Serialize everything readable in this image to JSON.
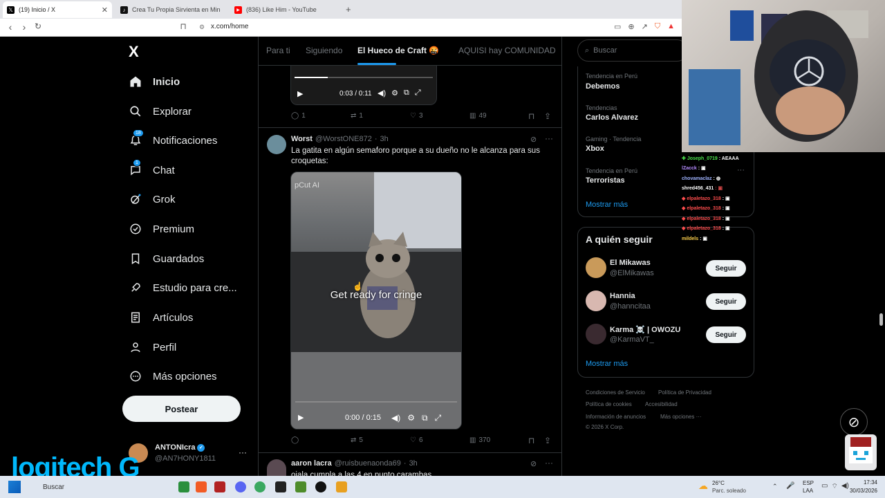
{
  "browser": {
    "tabs": [
      {
        "title": "(19) Inicio / X",
        "icon": "x-logo-icon"
      },
      {
        "title": "Crea Tu Propia Sirvienta en Minecraft",
        "icon": "tiktok-icon"
      },
      {
        "title": "(836) Like Him - YouTube",
        "icon": "youtube-icon"
      }
    ],
    "new_tab": "+",
    "url": "x.com/home"
  },
  "sidebar": {
    "logo": "X",
    "items": [
      {
        "label": "Inicio",
        "icon": "home-icon",
        "bold": true
      },
      {
        "label": "Explorar",
        "icon": "search-icon"
      },
      {
        "label": "Notificaciones",
        "icon": "bell-icon",
        "badge": "18"
      },
      {
        "label": "Chat",
        "icon": "chat-icon",
        "badge": "1"
      },
      {
        "label": "Grok",
        "icon": "grok-icon"
      },
      {
        "label": "Premium",
        "icon": "premium-icon"
      },
      {
        "label": "Guardados",
        "icon": "bookmark-icon"
      },
      {
        "label": "Estudio para cre...",
        "icon": "rocket-icon"
      },
      {
        "label": "Artículos",
        "icon": "article-icon"
      },
      {
        "label": "Perfil",
        "icon": "person-icon"
      },
      {
        "label": "Más opciones",
        "icon": "more-circle-icon"
      }
    ],
    "post_label": "Postear",
    "account": {
      "name": "ANTONIcra",
      "handle": "@AN7HONY1811"
    }
  },
  "feed_tabs": [
    "Para ti",
    "Siguiendo",
    "El Hueco de Craft 🤬",
    "AQUISI hay COMUNIDAD"
  ],
  "post_prev": {
    "video_time": "0:03 / 0:11",
    "replies": "1",
    "reposts": "1",
    "likes": "3",
    "views": "49"
  },
  "post_main": {
    "author": "Worst",
    "handle": "@WorstONE872",
    "time": "3h",
    "text": "La gatita en algún semaforo porque a su dueño no le alcanza para sus croquetas:",
    "watermark": "pCut AI",
    "caption": "Get ready for cringe",
    "video_time": "0:00 / 0:15",
    "replies": "",
    "reposts": "5",
    "likes": "6",
    "views": "370"
  },
  "post_next": {
    "author": "aaron lacra",
    "handle": "@ruisbuenaonda69",
    "time": "3h",
    "text": "ojala cumpla a las 4 en punto carambas"
  },
  "right": {
    "search_placeholder": "Buscar",
    "trends": [
      {
        "meta": "Tendencia en Perú",
        "title": "Debemos"
      },
      {
        "meta": "Tendencias",
        "title": "Carlos Alvarez"
      },
      {
        "meta": "Gaming · Tendencia",
        "title": "Xbox"
      },
      {
        "meta": "Tendencia en Perú",
        "title": "Terroristas"
      }
    ],
    "show_more": "Mostrar más",
    "who_to_follow_title": "A quién seguir",
    "follow": [
      {
        "name": "El Mikawas",
        "handle": "@ElMikawas"
      },
      {
        "name": "Hannia",
        "handle": "@hanncitaa"
      },
      {
        "name": "Karma ☠️ | OWOZU",
        "handle": "@KarmaVT_"
      }
    ],
    "follow_label": "Seguir",
    "footer": [
      "Condiciones de Servicio",
      "Política de Privacidad",
      "Política de cookies",
      "Accesibilidad",
      "Información de anuncios",
      "Más opciones ···",
      "© 2026 X Corp."
    ]
  },
  "stream_chat": [
    {
      "user": "Joseph_0719",
      "msg": "AEAAA",
      "color": "#4be34b"
    },
    {
      "user": "lZacck",
      "msg": "",
      "color": "#b58cff"
    },
    {
      "user": "chovamaclaz",
      "msg": "",
      "color": "#9fb3ff"
    },
    {
      "user": "shred456_431",
      "msg": "",
      "color": "#ffffff"
    },
    {
      "user": "elpaletazo_318",
      "msg": "",
      "color": "#ff4d4d"
    },
    {
      "user": "elpaletazo_318",
      "msg": "",
      "color": "#ff4d4d"
    },
    {
      "user": "elpaletazo_318",
      "msg": "",
      "color": "#ff4d4d"
    },
    {
      "user": "elpaletazo_318",
      "msg": "",
      "color": "#ff4d4d"
    },
    {
      "user": "mildels",
      "msg": "",
      "color": "#ffd24d"
    }
  ],
  "overlay": {
    "brand": "logitech G"
  },
  "taskbar": {
    "search": "Buscar",
    "weather_temp": "26°C",
    "weather_desc": "Parc. soleado",
    "lang": "ESP",
    "lang2": "LAA",
    "time": "17:34",
    "date": "30/03/2026"
  },
  "colors": {
    "accent": "#1d9bf0",
    "bg": "#000000",
    "border": "#2f3336"
  }
}
